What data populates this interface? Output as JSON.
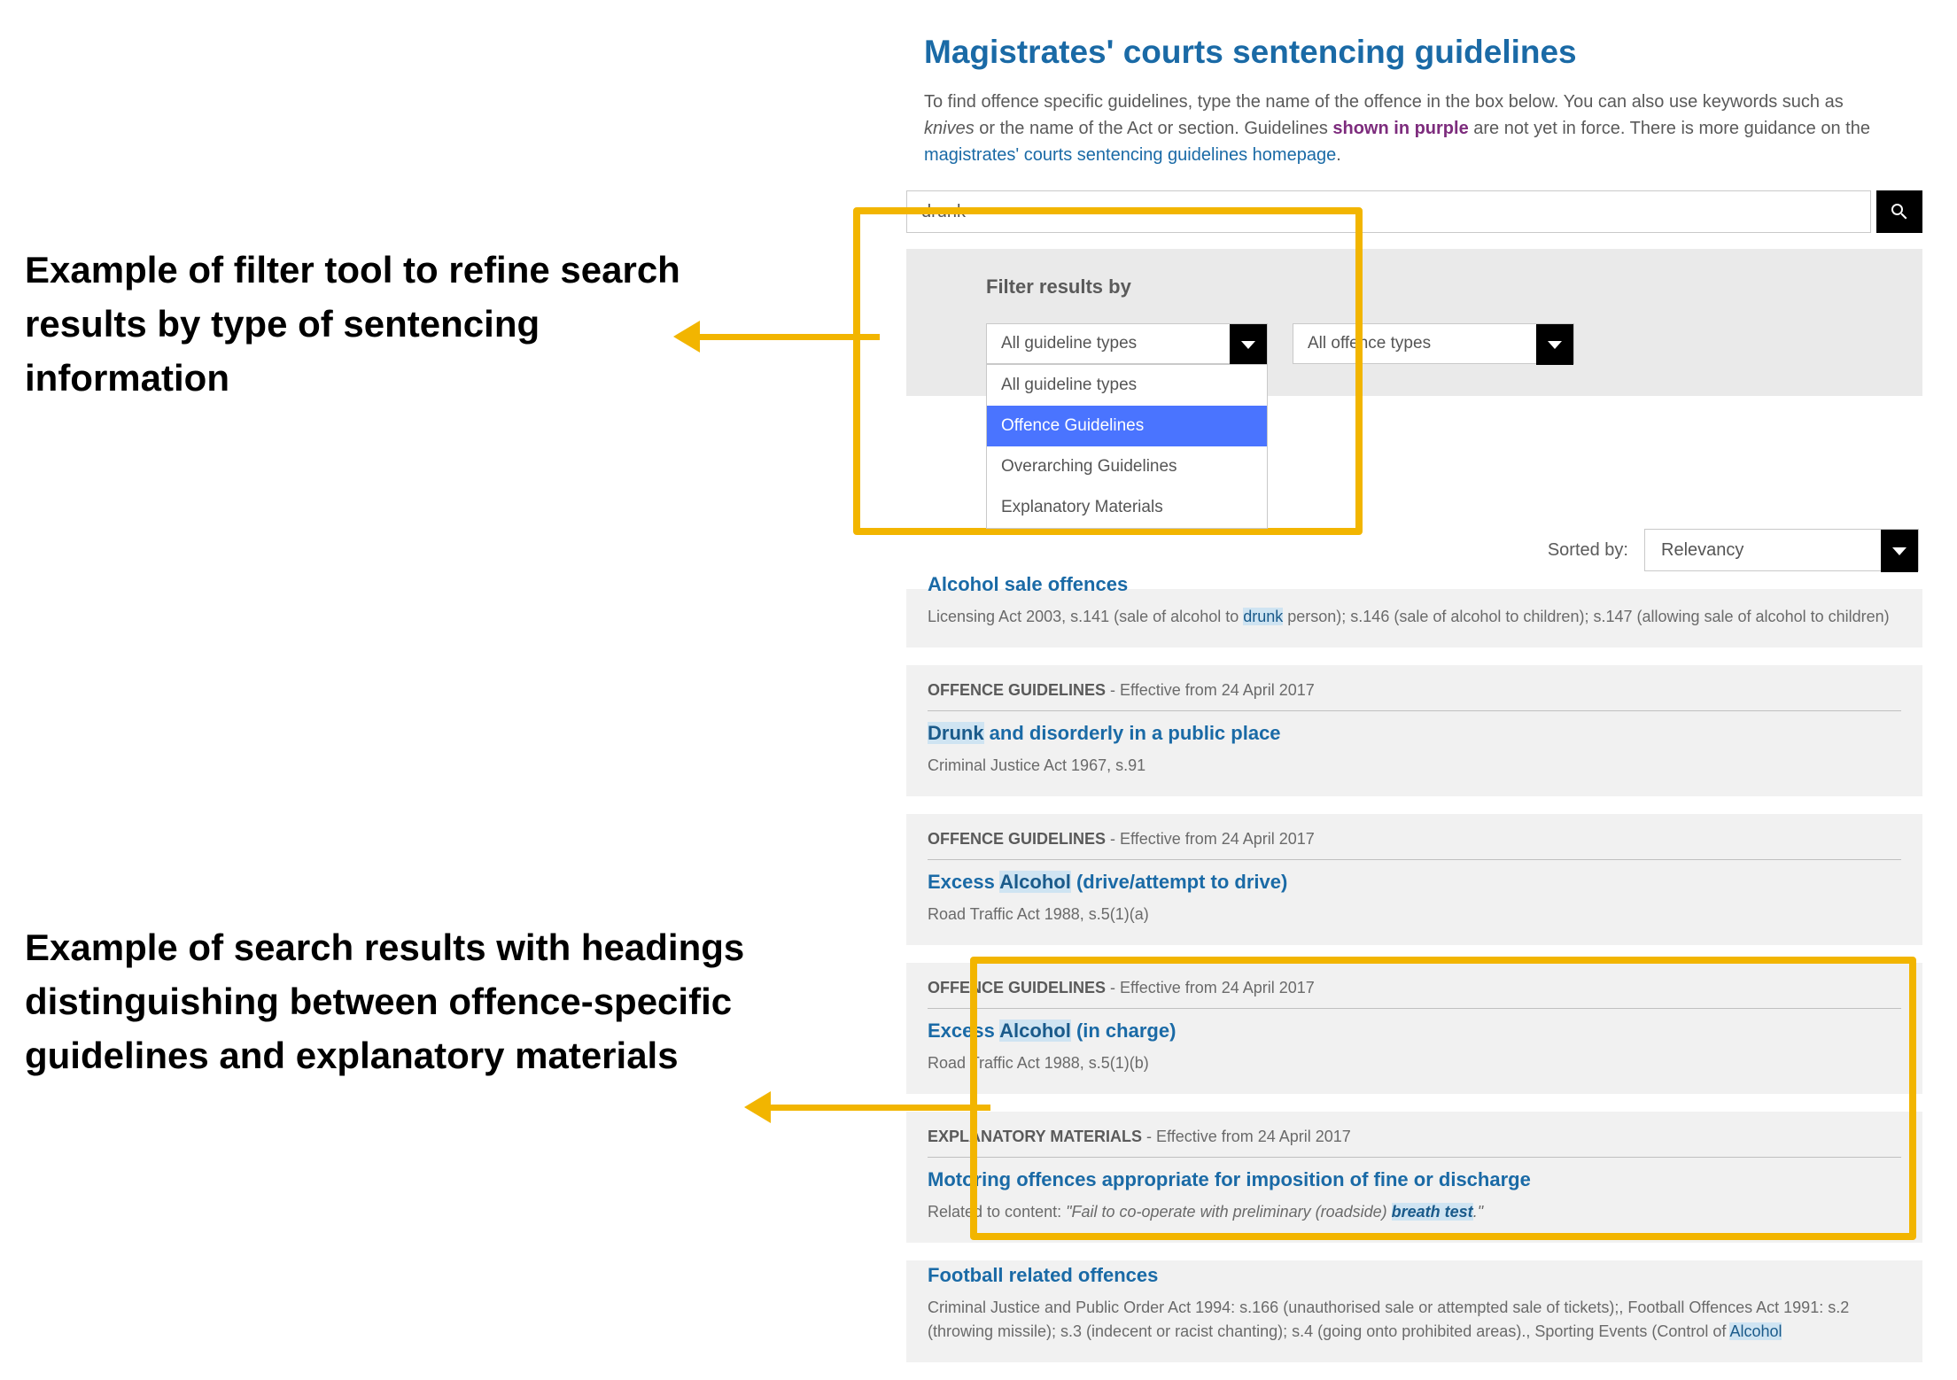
{
  "annotations": {
    "filter": "Example of filter tool to refine search results by type of sentencing information",
    "results": "Example of search results with headings distinguishing between offence-specific guidelines and explanatory materials"
  },
  "page": {
    "title": "Magistrates' courts sentencing guidelines",
    "intro_1": "To find offence specific guidelines, type the name of the offence in the box below. You can also use keywords such as ",
    "intro_knives": "knives",
    "intro_2": " or the name of the Act or section. Guidelines ",
    "intro_purple": "shown in purple",
    "intro_3": " are not yet in force. There is more guidance on the ",
    "intro_link": "magistrates' courts sentencing guidelines homepage",
    "intro_4": "."
  },
  "search": {
    "value": "drunk"
  },
  "filter": {
    "title": "Filter results by",
    "guideline_selected": "All guideline types",
    "offence_selected": "All offence types",
    "options": [
      "All guideline types",
      "Offence Guidelines",
      "Overarching Guidelines",
      "Explanatory Materials"
    ]
  },
  "sort": {
    "label": "Sorted by:",
    "value": "Relevancy"
  },
  "categories": {
    "offence": "OFFENCE GUIDELINES",
    "explanatory": "EXPLANATORY MATERIALS"
  },
  "effective": " - Effective from 24 April 2017",
  "results": [
    {
      "title_pre": "Alcohol sale offences",
      "desc_a": "Licensing Act 2003, s.141 (sale of alcohol to ",
      "desc_hl": "drunk",
      "desc_b": " person); s.146 (sale of alcohol to children); s.147 (allowing sale of alcohol to children)"
    },
    {
      "title_hl": "Drunk",
      "title_post": " and disorderly in a public place",
      "desc_a": "Criminal Justice Act 1967, s.91"
    },
    {
      "title_pre": "Excess ",
      "title_hl": "Alcohol",
      "title_post": " (drive/attempt to drive)",
      "desc_a": "Road Traffic Act 1988, s.5(1)(a)"
    },
    {
      "title_pre": "Excess ",
      "title_hl": "Alcohol",
      "title_post": " (in charge)",
      "desc_a": "Road Traffic Act 1988, s.5(1)(b)"
    },
    {
      "title_pre": "Motoring offences appropriate for imposition of fine or discharge",
      "desc_a": "Related to content: ",
      "desc_it_a": "\"Fail to co-operate with preliminary (roadside) ",
      "desc_hl": "breath test",
      "desc_it_b": ".\""
    },
    {
      "title_pre": "Football related offences",
      "desc_a": "Criminal Justice and Public Order Act 1994: s.166 (unauthorised sale or attempted sale of tickets);, Football Offences Act 1991: s.2 (throwing missile); s.3 (indecent or racist chanting); s.4 (going onto prohibited areas)., Sporting Events (Control of ",
      "desc_hl": "Alcohol"
    }
  ]
}
